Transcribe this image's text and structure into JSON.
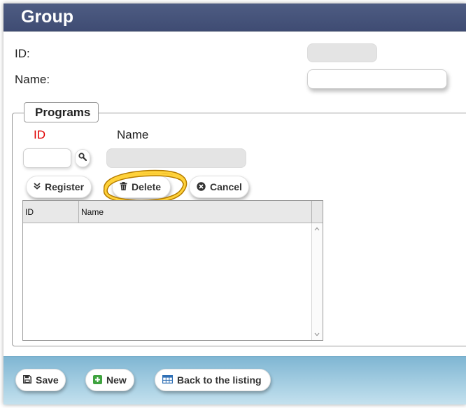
{
  "header": {
    "title": "Group"
  },
  "form": {
    "id_label": "ID:",
    "id_value": "",
    "name_label": "Name:",
    "name_value": ""
  },
  "programs": {
    "legend": "Programs",
    "id_column": "ID",
    "name_column": "Name",
    "id_value": "",
    "name_value": "",
    "buttons": {
      "register": "Register",
      "delete": "Delete",
      "cancel": "Cancel"
    },
    "grid": {
      "columns": [
        "ID",
        "Name"
      ],
      "rows": []
    }
  },
  "footer": {
    "save": "Save",
    "new": "New",
    "back": "Back to the listing"
  },
  "colors": {
    "title_bar": "#46537a",
    "required_label": "#e00000",
    "footer": "#a6d1e5",
    "new_icon": "#3fa33f",
    "grid_icon": "#2e6fb5",
    "highlight_ring": "#e0a800"
  }
}
